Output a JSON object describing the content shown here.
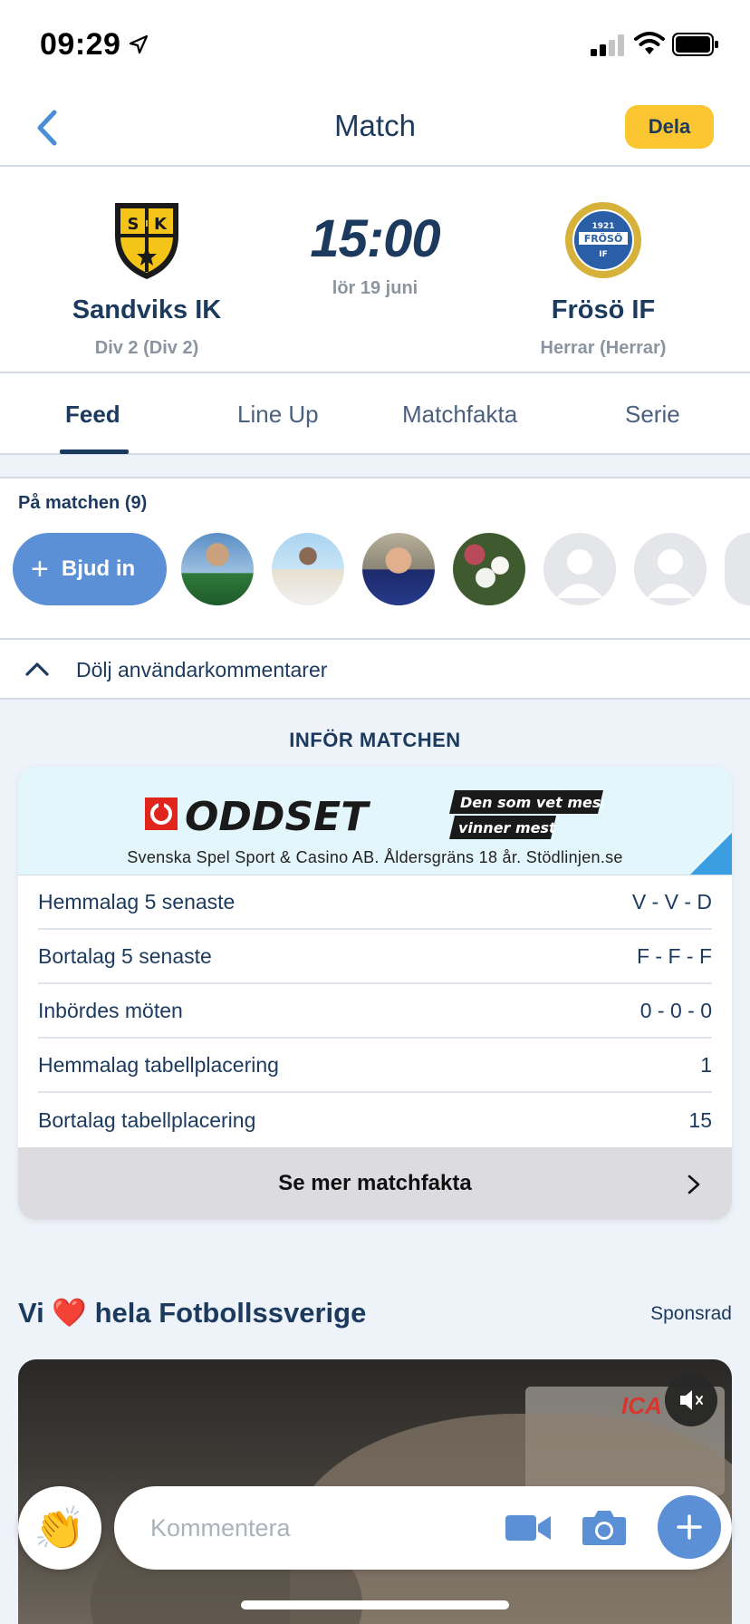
{
  "status_bar": {
    "time": "09:29"
  },
  "nav": {
    "title": "Match",
    "share_label": "Dela"
  },
  "match": {
    "home": {
      "name": "Sandviks IK",
      "division": "Div 2 (Div 2)",
      "crest_letters": "SIK"
    },
    "away": {
      "name": "Frösö IF",
      "division": "Herrar (Herrar)",
      "crest_text": "FRÖSÖ",
      "crest_year": "1921",
      "crest_letters": "IF"
    },
    "kickoff_time": "15:00",
    "kickoff_date": "lör 19 juni"
  },
  "tabs": [
    "Feed",
    "Line Up",
    "Matchfakta",
    "Serie"
  ],
  "active_tab": "Feed",
  "attendees": {
    "title": "På matchen (9)",
    "invite_label": "Bjud in"
  },
  "comments_toggle": {
    "label": "Dölj användarkommentarer"
  },
  "pre_match": {
    "heading": "INFÖR MATCHEN",
    "ad": {
      "brand": "ODDSET",
      "tagline_1": "Den som vet mest",
      "tagline_2": "vinner mest",
      "disclaimer": "Svenska Spel Sport & Casino AB. Åldersgräns 18 år. Stödlinjen.se"
    },
    "stats": [
      {
        "label": "Hemmalag 5 senaste",
        "value": "V - V - D"
      },
      {
        "label": "Bortalag 5 senaste",
        "value": "F - F - F"
      },
      {
        "label": "Inbördes möten",
        "value": "0 - 0 - 0"
      },
      {
        "label": "Hemmalag tabellplacering",
        "value": "1"
      },
      {
        "label": "Bortalag tabellplacering",
        "value": "15"
      }
    ],
    "more_label": "Se mer matchfakta"
  },
  "sponsored": {
    "title_pre": "Vi",
    "heart": "❤️",
    "title_post": "hela Fotbollssverige",
    "tag": "Sponsrad",
    "video_brand": "ICA"
  },
  "comment_bar": {
    "placeholder": "Kommentera",
    "clap_emoji": "👏"
  },
  "colors": {
    "primary": "#1c3a5e",
    "accent_blue": "#5b8fd6",
    "share_yellow": "#fcc632",
    "muted": "#8c959f"
  }
}
